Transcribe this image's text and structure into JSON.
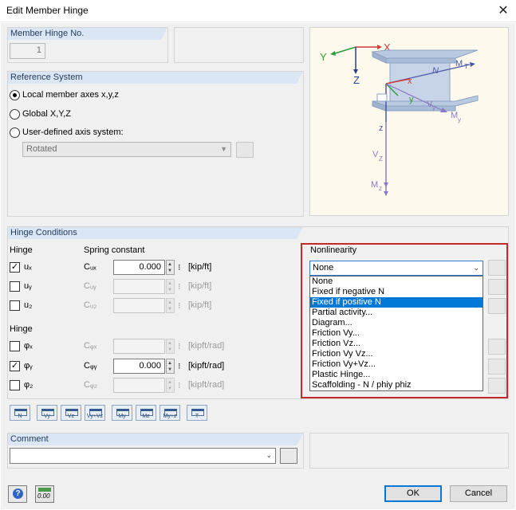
{
  "window": {
    "title": "Edit Member Hinge"
  },
  "member_hinge": {
    "header": "Member Hinge No.",
    "number": "1"
  },
  "reference_system": {
    "header": "Reference System",
    "options": [
      {
        "label": "Local member axes x,y,z",
        "selected": true
      },
      {
        "label": "Global X,Y,Z",
        "selected": false
      },
      {
        "label": "User-defined axis system:",
        "selected": false
      }
    ],
    "axis_system_value": "Rotated"
  },
  "diagram": {
    "labels": {
      "x": "X",
      "y": "Y",
      "z": "Z",
      "n": "N",
      "mt": "M",
      "mt_sub": "T",
      "lx": "x",
      "ly": "y",
      "lz": "z",
      "vy": "V",
      "vy_sub": "y",
      "my": "M",
      "my_sub": "y",
      "vz": "V",
      "vz_sub": "Z",
      "mz": "M",
      "mz_sub": "z"
    }
  },
  "hinge_conditions": {
    "header": "Hinge Conditions",
    "hinge_label": "Hinge",
    "spring_label": "Spring constant",
    "nonlinearity_label": "Nonlinearity",
    "hinge2_label": "Hinge",
    "rows": [
      {
        "sym": "uₓ",
        "checked": true,
        "c": "Cᵤₓ",
        "value": "0.000",
        "unit": "[kip/ft]",
        "enabled": true
      },
      {
        "sym": "uᵧ",
        "checked": false,
        "c": "Cᵤᵧ",
        "value": "",
        "unit": "[kip/ft]",
        "enabled": false
      },
      {
        "sym": "u₂",
        "checked": false,
        "c": "Cᵤ₂",
        "value": "",
        "unit": "[kip/ft]",
        "enabled": false
      },
      {
        "sym": "φₓ",
        "checked": false,
        "c": "Cᵩₓ",
        "value": "",
        "unit": "[kipft/rad]",
        "enabled": false
      },
      {
        "sym": "φᵧ",
        "checked": true,
        "c": "Cᵩᵧ",
        "value": "0.000",
        "unit": "[kipft/rad]",
        "enabled": true
      },
      {
        "sym": "φ₂",
        "checked": false,
        "c": "Cᵩ₂",
        "value": "",
        "unit": "[kipft/rad]",
        "enabled": false
      }
    ],
    "nonlinearity_value": "None",
    "nonlinearity_options": [
      "None",
      "Fixed if negative N",
      "Fixed if positive N",
      "Partial activity...",
      "Diagram...",
      "Friction Vy...",
      "Friction Vz...",
      "Friction Vy Vz...",
      "Friction Vy+Vz...",
      "Plastic Hinge...",
      "Scaffolding - N / phiy phiz"
    ],
    "nonlinearity_selected_index": 2
  },
  "toolbar": {
    "buttons": [
      "N",
      "Vy",
      "Vz",
      "Vy+Vz",
      "My",
      "Mz",
      "My+z",
      "T"
    ]
  },
  "comment": {
    "header": "Comment",
    "value": ""
  },
  "footer": {
    "ok_label": "OK",
    "cancel_label": "Cancel",
    "units_label": "0.00"
  },
  "colors": {
    "accent": "#0078d7",
    "highlight_frame": "#c32a2a",
    "panel_header": "#dbe6f4"
  }
}
